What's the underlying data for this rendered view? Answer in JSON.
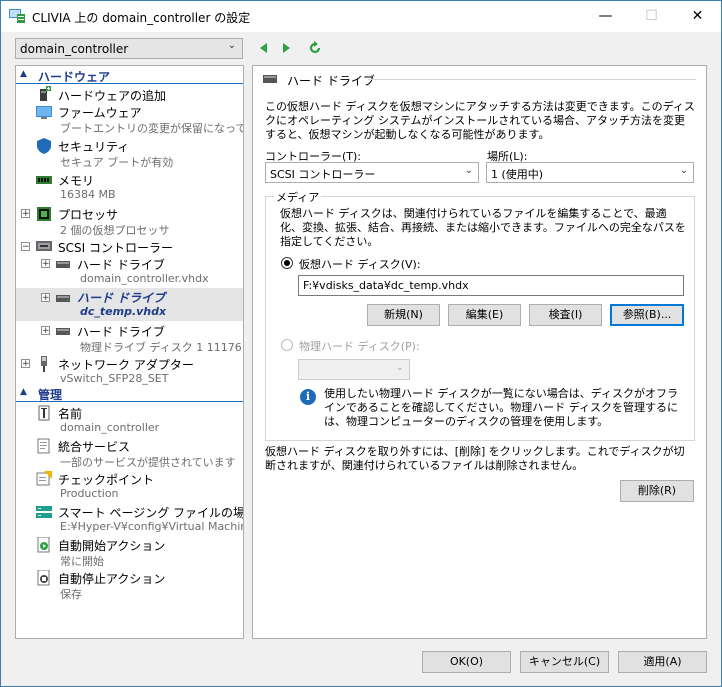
{
  "window": {
    "title": "CLIVIA 上の domain_controller の設定",
    "minimize_glyph": "—",
    "maximize_glyph": "☐",
    "close_glyph": "✕"
  },
  "vm_selector": {
    "value": "domain_controller"
  },
  "tree": {
    "hardware_section": "ハードウェア",
    "hardware_items": [
      {
        "label": "ハードウェアの追加",
        "sub": ""
      },
      {
        "label": "ファームウェア",
        "sub": "ブートエントリの変更が保留になって..."
      },
      {
        "label": "セキュリティ",
        "sub": "セキュア ブートが有効"
      },
      {
        "label": "メモリ",
        "sub": "16384 MB"
      },
      {
        "label": "プロセッサ",
        "sub": "2 個の仮想プロセッサ"
      },
      {
        "label": "SCSI コントローラー",
        "sub": ""
      },
      {
        "label": "ハード ドライブ",
        "sub": "domain_controller.vhdx"
      },
      {
        "label": "ハード ドライブ",
        "sub": "dc_temp.vhdx"
      },
      {
        "label": "ハード ドライブ",
        "sub": "物理ドライブ ディスク 1 11176.0..."
      },
      {
        "label": "ネットワーク アダプター",
        "sub": "vSwitch_SFP28_SET"
      }
    ],
    "management_section": "管理",
    "management_items": [
      {
        "label": "名前",
        "sub": "domain_controller"
      },
      {
        "label": "統合サービス",
        "sub": "一部のサービスが提供されています"
      },
      {
        "label": "チェックポイント",
        "sub": "Production"
      },
      {
        "label": "スマート ページング ファイルの場所",
        "sub": "E:¥Hyper-V¥config¥Virtual Machin..."
      },
      {
        "label": "自動開始アクション",
        "sub": "常に開始"
      },
      {
        "label": "自動停止アクション",
        "sub": "保存"
      }
    ]
  },
  "panel": {
    "heading": "ハード ドライブ",
    "description": "この仮想ハード ディスクを仮想マシンにアタッチする方法は変更できます。このディスクにオペレーティング システムがインストールされている場合、アタッチ方法を変更すると、仮想マシンが起動しなくなる可能性があります。",
    "controller_label": "コントローラー(T):",
    "controller_value": "SCSI コントローラー",
    "location_label": "場所(L):",
    "location_value": "1 (使用中)",
    "media_title": "メディア",
    "media_description": "仮想ハード ディスクは、関連付けられているファイルを編集することで、最適化、変換、拡張、結合、再接続、または縮小できます。ファイルへの完全なパスを指定してください。",
    "vhd_radio_label": "仮想ハード ディスク(V):",
    "vhd_path": "F:¥vdisks_data¥dc_temp.vhdx",
    "btn_new": "新規(N)",
    "btn_edit": "編集(E)",
    "btn_inspect": "検査(I)",
    "btn_browse": "参照(B)...",
    "phys_radio_label": "物理ハード ディスク(P):",
    "phys_info": "使用したい物理ハード ディスクが一覧にない場合は、ディスクがオフラインであることを確認してください。物理ハード ディスクを管理するには、物理コンピューターのディスクの管理を使用します。",
    "remove_description": "仮想ハード ディスクを取り外すには、[削除] をクリックします。これでディスクが切断されますが、関連付けられているファイルは削除されません。",
    "btn_remove": "削除(R)"
  },
  "footer": {
    "ok": "OK(O)",
    "cancel": "キャンセル(C)",
    "apply": "適用(A)"
  }
}
